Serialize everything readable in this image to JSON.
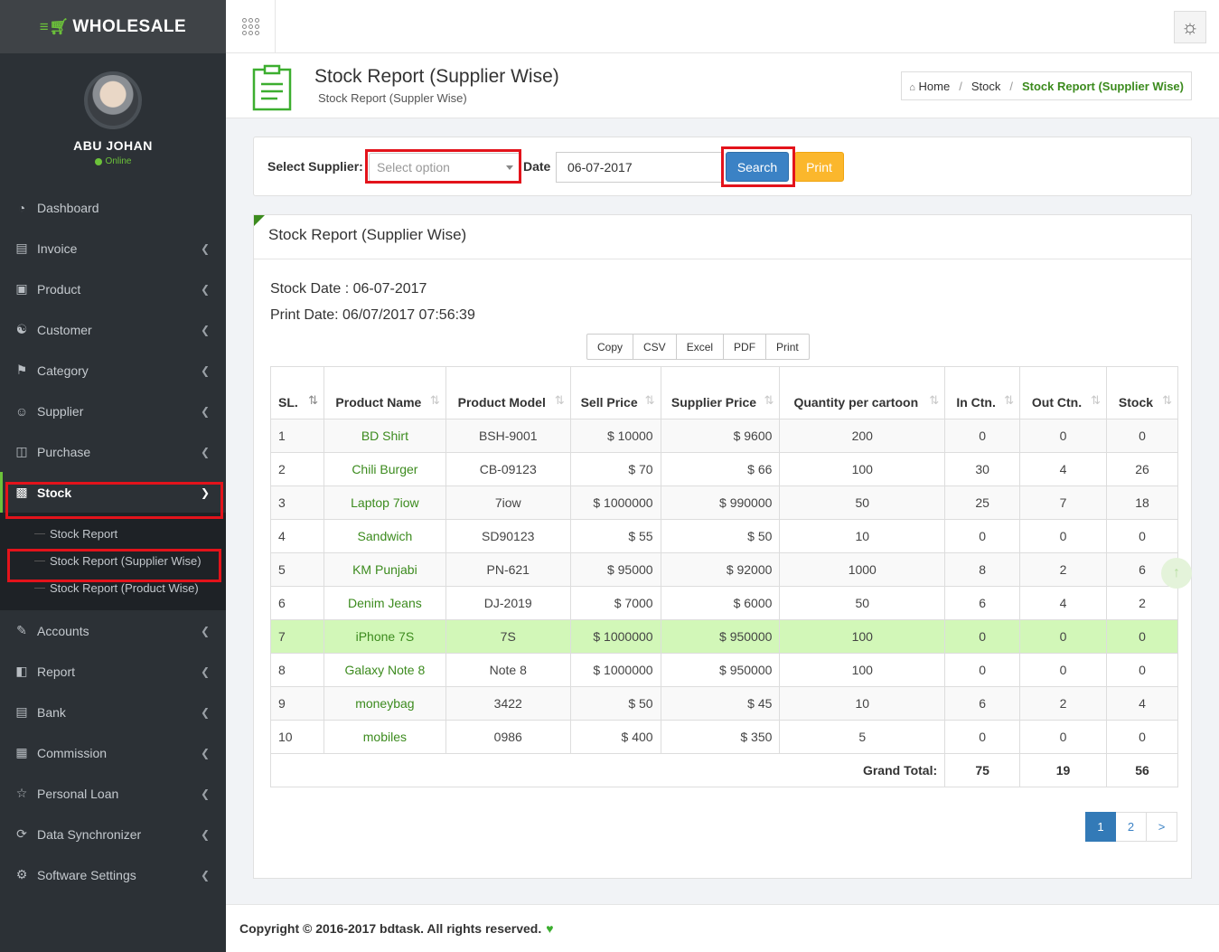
{
  "app": {
    "logo_text": "WHOLESALE",
    "accent": "#6cc23a"
  },
  "user": {
    "name": "ABU JOHAN",
    "status": "Online"
  },
  "sidebar": {
    "items": [
      {
        "label": "Dashboard",
        "icon": "dashboard-icon"
      },
      {
        "label": "Invoice",
        "icon": "invoice-icon"
      },
      {
        "label": "Product",
        "icon": "product-icon"
      },
      {
        "label": "Customer",
        "icon": "handshake-icon"
      },
      {
        "label": "Category",
        "icon": "tag-icon"
      },
      {
        "label": "Supplier",
        "icon": "user-icon"
      },
      {
        "label": "Purchase",
        "icon": "cart-icon"
      },
      {
        "label": "Stock",
        "icon": "bar-chart-icon"
      },
      {
        "label": "Accounts",
        "icon": "edit-icon"
      },
      {
        "label": "Report",
        "icon": "book-icon"
      },
      {
        "label": "Bank",
        "icon": "bank-icon"
      },
      {
        "label": "Commission",
        "icon": "grid-icon"
      },
      {
        "label": "Personal Loan",
        "icon": "star-icon"
      },
      {
        "label": "Data Synchronizer",
        "icon": "refresh-icon"
      },
      {
        "label": "Software Settings",
        "icon": "gear-icon"
      }
    ],
    "stock_sub": [
      "Stock Report",
      "Stock Report (Supplier Wise)",
      "Stock Report (Product Wise)"
    ]
  },
  "header": {
    "title": "Stock Report (Supplier Wise)",
    "subtitle": "Stock Report (Suppler Wise)",
    "breadcrumb": [
      "Home",
      "Stock",
      "Stock Report (Supplier Wise)"
    ]
  },
  "filter": {
    "supplier_label": "Select Supplier:",
    "supplier_placeholder": "Select option",
    "date_label": "Date",
    "date_value": "06-07-2017",
    "search_label": "Search",
    "print_label": "Print"
  },
  "report": {
    "title": "Stock Report (Supplier Wise)",
    "stock_date": "Stock Date : 06-07-2017",
    "print_date": "Print Date: 06/07/2017 07:56:39",
    "export_buttons": [
      "Copy",
      "CSV",
      "Excel",
      "PDF",
      "Print"
    ],
    "columns": [
      "SL.",
      "Product Name",
      "Product Model",
      "Sell Price",
      "Supplier Price",
      "Quantity per cartoon",
      "In Ctn.",
      "Out Ctn.",
      "Stock"
    ],
    "rows": [
      [
        "1",
        "BD Shirt",
        "BSH-9001",
        "$ 10000",
        "$ 9600",
        "200",
        "0",
        "0",
        "0"
      ],
      [
        "2",
        "Chili Burger",
        "CB-09123",
        "$ 70",
        "$ 66",
        "100",
        "30",
        "4",
        "26"
      ],
      [
        "3",
        "Laptop 7iow",
        "7iow",
        "$ 1000000",
        "$ 990000",
        "50",
        "25",
        "7",
        "18"
      ],
      [
        "4",
        "Sandwich",
        "SD90123",
        "$ 55",
        "$ 50",
        "10",
        "0",
        "0",
        "0"
      ],
      [
        "5",
        "KM Punjabi",
        "PN-621",
        "$ 95000",
        "$ 92000",
        "1000",
        "8",
        "2",
        "6"
      ],
      [
        "6",
        "Denim Jeans",
        "DJ-2019",
        "$ 7000",
        "$ 6000",
        "50",
        "6",
        "4",
        "2"
      ],
      [
        "7",
        "iPhone 7S",
        "7S",
        "$ 1000000",
        "$ 950000",
        "100",
        "0",
        "0",
        "0"
      ],
      [
        "8",
        "Galaxy Note 8",
        "Note 8",
        "$ 1000000",
        "$ 950000",
        "100",
        "0",
        "0",
        "0"
      ],
      [
        "9",
        "moneybag",
        "3422",
        "$ 50",
        "$ 45",
        "10",
        "6",
        "2",
        "4"
      ],
      [
        "10",
        "mobiles",
        "0986",
        "$ 400",
        "$ 350",
        "5",
        "0",
        "0",
        "0"
      ]
    ],
    "highlight_row": 7,
    "grand_total_label": "Grand Total:",
    "totals": {
      "in": "75",
      "out": "19",
      "stock": "56"
    },
    "pages": [
      "1",
      "2",
      ">"
    ]
  },
  "footer": {
    "text": "Copyright © 2016-2017 bdtask. All rights reserved."
  }
}
